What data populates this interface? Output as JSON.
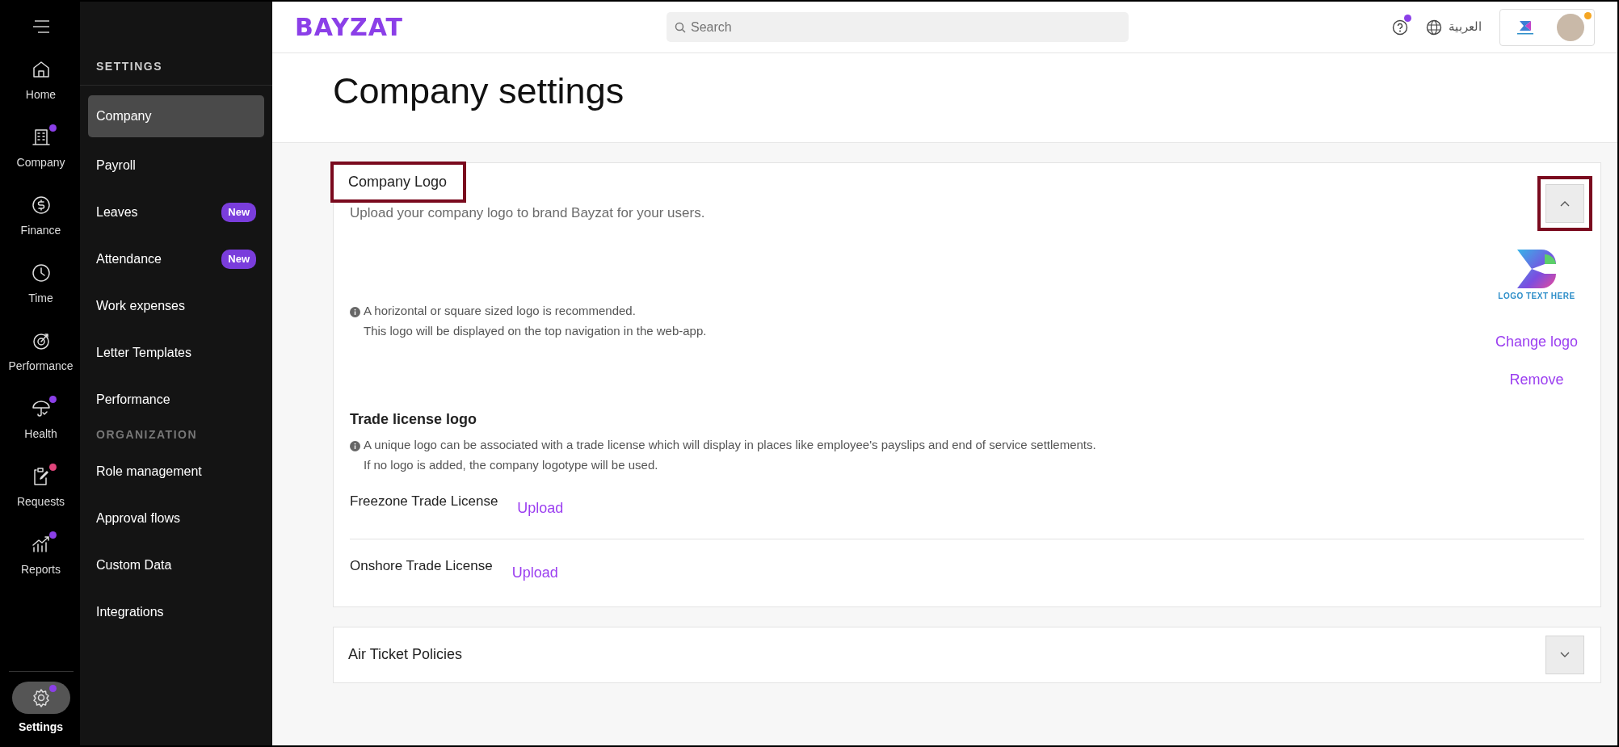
{
  "rail": {
    "items": [
      {
        "label": "Home",
        "selected": false
      },
      {
        "label": "Company",
        "color": "#8b3fe8",
        "selected": false
      },
      {
        "label": "Finance",
        "selected": false
      },
      {
        "label": "Time",
        "selected": false
      },
      {
        "label": "Performance",
        "selected": false
      },
      {
        "label": "Health",
        "color": "#8b3fe8",
        "selected": false
      },
      {
        "label": "Requests",
        "color": "#e0457b",
        "selected": false
      },
      {
        "label": "Reports",
        "color": "#8b3fe8",
        "selected": false
      }
    ],
    "bottom": {
      "label": "Settings",
      "color": "#8b3fe8",
      "selected": true
    }
  },
  "settings_menu": {
    "sections": [
      {
        "heading": "SETTINGS",
        "items": [
          {
            "label": "Company",
            "selected": true
          },
          {
            "label": "Payroll",
            "selected": false
          },
          {
            "label": "Leaves",
            "selected": false,
            "badge": "New"
          },
          {
            "label": "Attendance",
            "selected": false,
            "badge": "New"
          },
          {
            "label": "Work expenses",
            "selected": false
          },
          {
            "label": "Letter Templates",
            "selected": false
          },
          {
            "label": "Performance",
            "selected": false
          }
        ]
      },
      {
        "heading": "ORGANIZATION",
        "items": [
          {
            "label": "Role management",
            "selected": false
          },
          {
            "label": "Approval flows",
            "selected": false
          },
          {
            "label": "Custom Data",
            "selected": false
          },
          {
            "label": "Integrations",
            "selected": false
          }
        ]
      }
    ]
  },
  "top_bar": {
    "brand": "BAYZAT",
    "search": {
      "placeholder": "Search"
    },
    "help_notification": true,
    "language": "العربية",
    "account_notification": true
  },
  "page_title": "Company settings",
  "panels": [
    {
      "title": "Company Logo",
      "expanded": true,
      "highlighted": true,
      "description": "Upload your company logo to brand Bayzat for your users.",
      "logo_notes": [
        "A horizontal or square sized logo is recommended.",
        "This logo will be displayed on the top navigation in the web-app."
      ],
      "logo_text": "LOGO TEXT HERE",
      "actions": [
        "Change logo",
        "Remove"
      ],
      "trade_title": "Trade license logo",
      "trade_notes": [
        "A unique logo can be associated with a trade license which will display in places like employee's payslips and end of service settlements.",
        "If no logo is added, the company logotype will be used."
      ],
      "licenses": [
        {
          "name": "Freezone Trade License",
          "action": "Upload"
        },
        {
          "name": "Onshore Trade License",
          "action": "Upload"
        }
      ]
    },
    {
      "title": "Air Ticket Policies",
      "expanded": false,
      "highlighted": false
    }
  ]
}
